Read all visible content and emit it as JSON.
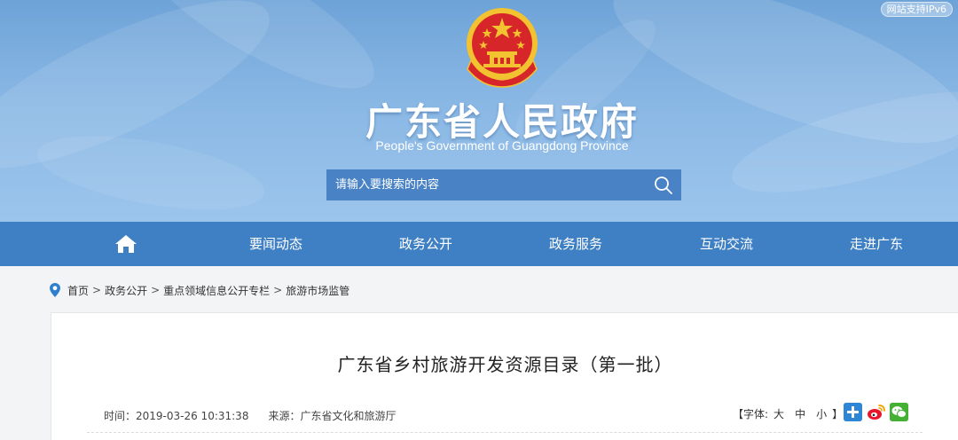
{
  "colors": {
    "banner_top": "#6ea3d8",
    "nav_bg": "#3f80c4",
    "search_bg": "#4a86c8",
    "page_bg": "#f3f4f6",
    "emblem_red": "#d7262a",
    "emblem_gold": "#f2c230"
  },
  "header": {
    "ipv6_badge": "网站支持IPv6",
    "site_title": "广东省人民政府",
    "site_subtitle": "People's Government of Guangdong Province",
    "emblem_icon": "national-emblem-icon"
  },
  "search": {
    "placeholder": "请输入要搜索的内容",
    "icon": "search-icon"
  },
  "nav": {
    "home_icon": "home-icon",
    "items": [
      "要闻动态",
      "政务公开",
      "政务服务",
      "互动交流",
      "走进广东"
    ]
  },
  "breadcrumb": {
    "icon": "location-pin-icon",
    "items": [
      "首页",
      "政务公开",
      "重点领域信息公开专栏",
      "旅游市场监管"
    ],
    "separator": ">"
  },
  "article": {
    "title": "广东省乡村旅游开发资源目录（第一批）",
    "time_label": "时间：2019-03-26 10:31:38",
    "source_label": "来源：广东省文化和旅游厅",
    "font_size": {
      "open": "【字体:",
      "large": "大",
      "medium": "中",
      "small": "小",
      "close": "】"
    },
    "share_icons": [
      "share-plus-icon",
      "weibo-icon",
      "wechat-icon"
    ]
  }
}
